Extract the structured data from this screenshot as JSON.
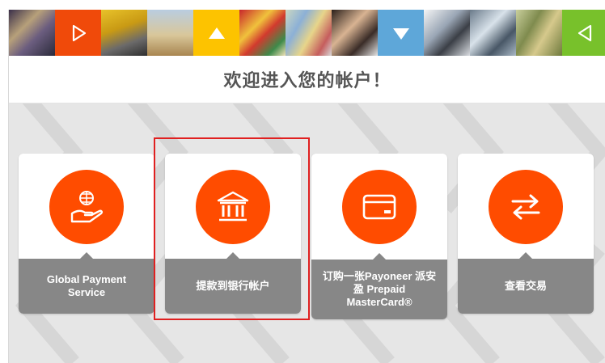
{
  "header": {
    "title": "欢迎进入您的帐户！",
    "arrows": [
      {
        "icon": "play-right-outline-icon",
        "color": "#f04a0a"
      },
      {
        "icon": "triangle-up-icon",
        "color": "#fdc300"
      },
      {
        "icon": "triangle-down-icon",
        "color": "#5ea7d9"
      },
      {
        "icon": "play-left-outline-icon",
        "color": "#78c12b"
      }
    ]
  },
  "accent_color": "#ff4c00",
  "cards": [
    {
      "id": "global-payment",
      "label": "Global Payment Service",
      "icon": "hand-globe-icon"
    },
    {
      "id": "withdraw",
      "label": "提款到银行帐户",
      "icon": "bank-icon",
      "selected": true
    },
    {
      "id": "prepaid-card",
      "label": "订购一张Payoneer 派安盈 Prepaid MasterCard®",
      "icon": "credit-card-icon"
    },
    {
      "id": "transactions",
      "label": "查看交易",
      "icon": "transfer-arrows-icon"
    }
  ]
}
